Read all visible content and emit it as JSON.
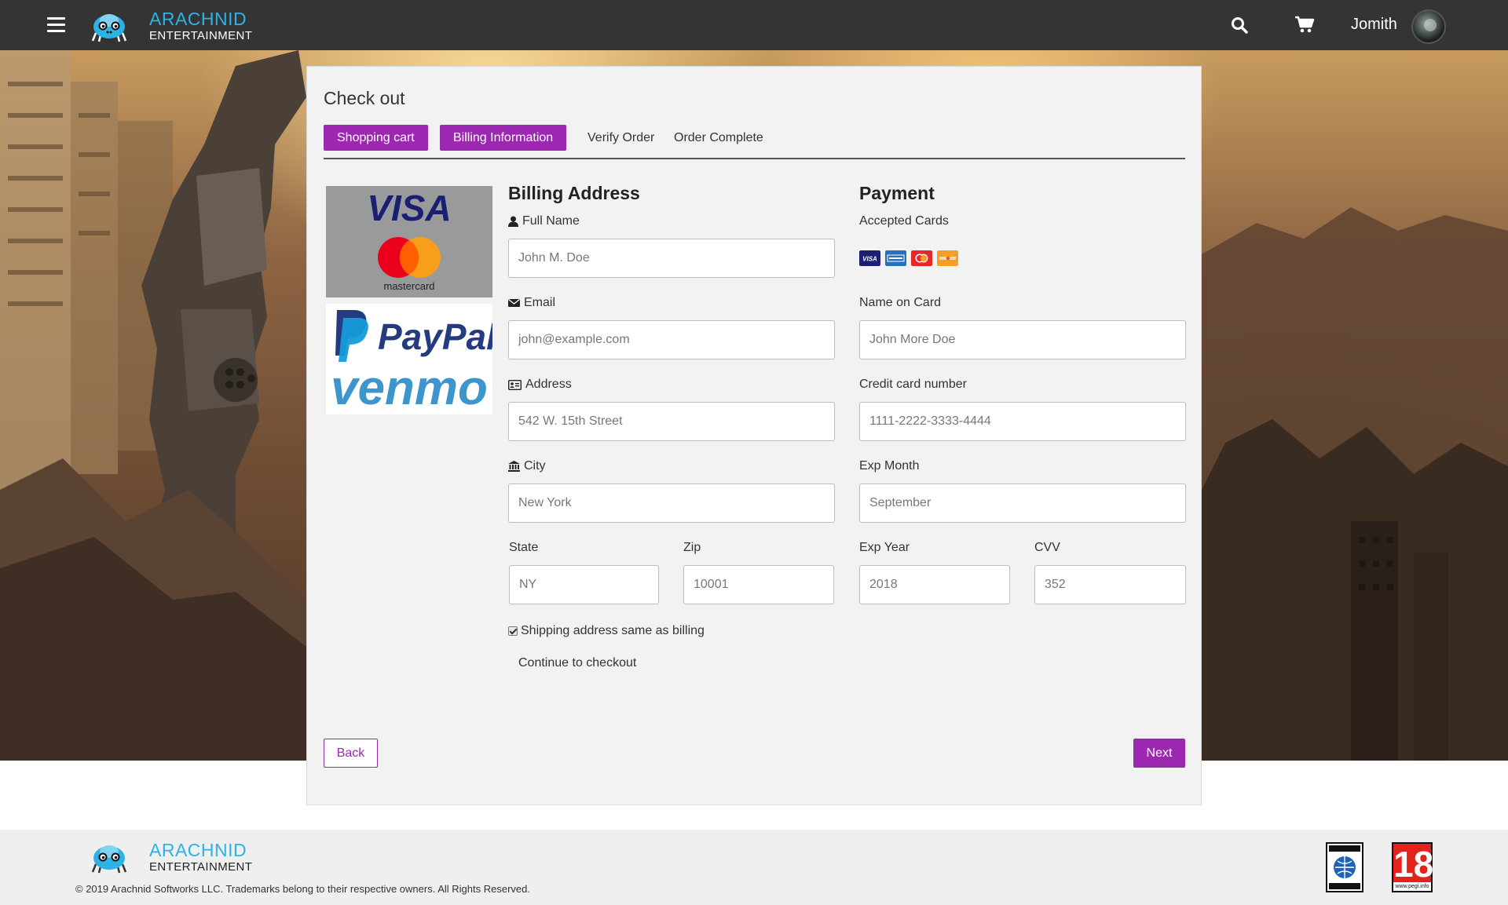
{
  "header": {
    "brand_name": "ARACHNID",
    "brand_sub": "ENTERTAINMENT",
    "username": "Jomith"
  },
  "checkout": {
    "title": "Check out",
    "steps": [
      {
        "label": "Shopping cart",
        "active": true
      },
      {
        "label": "Billing Information",
        "active": true
      },
      {
        "label": "Verify Order",
        "active": false
      },
      {
        "label": "Order Complete",
        "active": false
      }
    ],
    "billing": {
      "title": "Billing Address",
      "full_name_label": "Full Name",
      "full_name_placeholder": "John M. Doe",
      "email_label": "Email",
      "email_placeholder": "john@example.com",
      "address_label": "Address",
      "address_placeholder": "542 W. 15th Street",
      "city_label": "City",
      "city_placeholder": "New York",
      "state_label": "State",
      "state_placeholder": "NY",
      "zip_label": "Zip",
      "zip_placeholder": "10001"
    },
    "payment": {
      "title": "Payment",
      "accepted_cards_label": "Accepted Cards",
      "accepted_cards": [
        "visa-icon",
        "amex-icon",
        "mastercard-icon",
        "discover-icon"
      ],
      "name_on_card_label": "Name on Card",
      "name_on_card_placeholder": "John More Doe",
      "card_number_label": "Credit card number",
      "card_number_placeholder": "1111-2222-3333-4444",
      "exp_month_label": "Exp Month",
      "exp_month_placeholder": "September",
      "exp_year_label": "Exp Year",
      "exp_year_placeholder": "2018",
      "cvv_label": "CVV",
      "cvv_placeholder": "352"
    },
    "logos": {
      "visa": "VISA",
      "mastercard": "mastercard",
      "paypal": "PayPal",
      "venmo": "venmo"
    },
    "shipping_same_label": "Shipping address same as billing",
    "shipping_same_checked": true,
    "continue_label": "Continue to checkout",
    "back_label": "Back",
    "next_label": "Next"
  },
  "footer": {
    "brand_name": "ARACHNID",
    "brand_sub": "ENTERTAINMENT",
    "copyright": "© 2019 Arachnid Softworks LLC. Trademarks belong to their respective owners. All Rights Reserved.",
    "pegi_rating": "18",
    "pegi_url": "www.pegi.info"
  },
  "colors": {
    "accent": "#9c27b0",
    "header_bg": "#343434",
    "brand_blue": "#2cb3e6"
  }
}
